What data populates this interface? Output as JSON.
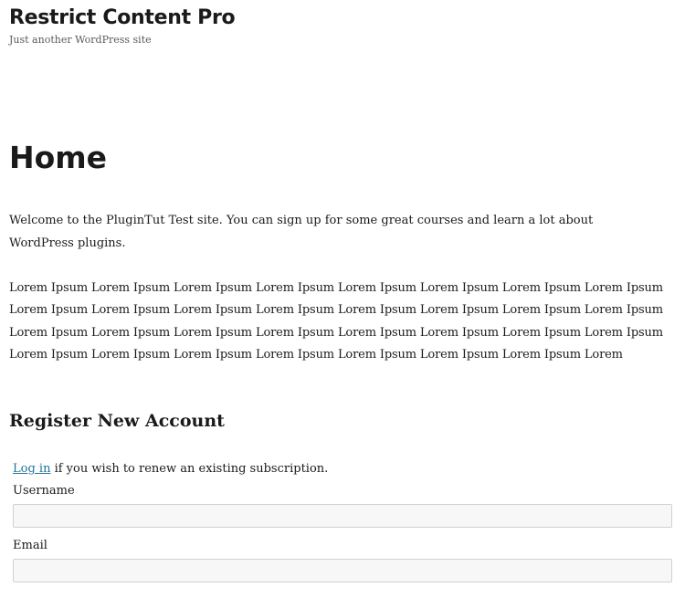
{
  "site": {
    "title": "Restrict Content Pro",
    "tagline": "Just another WordPress site"
  },
  "page": {
    "title": "Home",
    "welcome": "Welcome to the PluginTut Test site. You can sign up for some great courses and learn a lot about WordPress plugins.",
    "lorem": "Lorem Ipsum Lorem Ipsum Lorem Ipsum Lorem Ipsum Lorem Ipsum Lorem Ipsum Lorem Ipsum Lorem Ipsum Lorem Ipsum Lorem Ipsum Lorem Ipsum Lorem Ipsum Lorem Ipsum Lorem Ipsum Lorem Ipsum Lorem Ipsum Lorem Ipsum Lorem Ipsum Lorem Ipsum Lorem Ipsum Lorem Ipsum Lorem Ipsum Lorem Ipsum Lorem Ipsum Lorem Ipsum Lorem Ipsum Lorem Ipsum Lorem Ipsum Lorem Ipsum Lorem Ipsum Lorem Ipsum Lorem"
  },
  "register": {
    "heading": "Register New Account",
    "login_link": "Log in",
    "login_text": " if you wish to renew an existing subscription.",
    "username_label": "Username",
    "username_value": "",
    "email_label": "Email",
    "email_value": ""
  },
  "colors": {
    "link": "#21759b",
    "input_bg": "#f7f7f7",
    "input_border": "#d1d1d1",
    "text": "#1a1a1a",
    "muted": "#5a5a5a"
  }
}
